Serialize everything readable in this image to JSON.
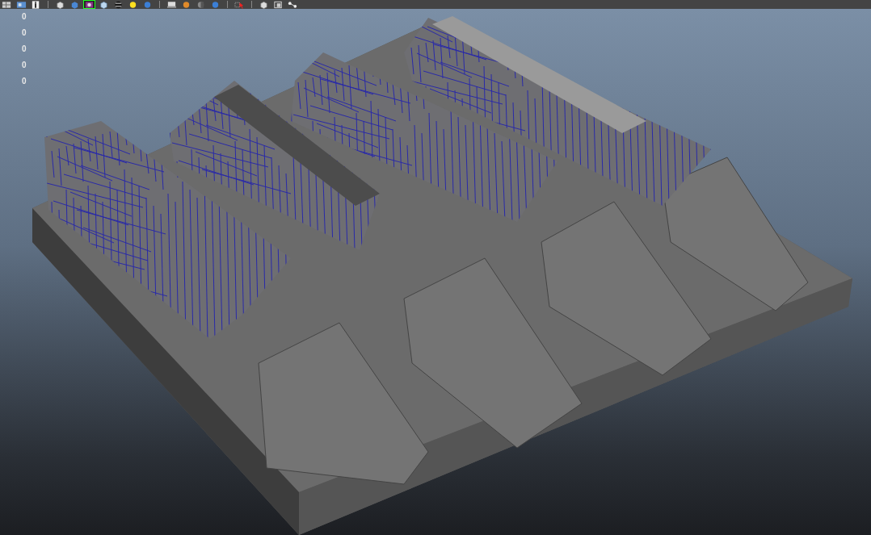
{
  "toolbar": {
    "groups": [
      {
        "buttons": [
          {
            "kind": "grid",
            "selected": false
          },
          {
            "kind": "shaded",
            "selected": false
          },
          {
            "kind": "info",
            "selected": false
          }
        ]
      },
      {
        "buttons": [
          {
            "kind": "cube",
            "selected": false
          },
          {
            "kind": "cube-blue",
            "selected": false
          },
          {
            "kind": "texture",
            "selected": true
          },
          {
            "kind": "cube-light",
            "selected": false
          },
          {
            "kind": "sphere-bw",
            "selected": false
          },
          {
            "kind": "bulb",
            "selected": false
          },
          {
            "kind": "sphere-blue",
            "selected": false
          }
        ]
      },
      {
        "buttons": [
          {
            "kind": "monitor",
            "selected": false
          },
          {
            "kind": "sphere-orange",
            "selected": false
          },
          {
            "kind": "sphere-grey",
            "selected": false
          },
          {
            "kind": "sphere-blue",
            "selected": false
          }
        ]
      },
      {
        "buttons": [
          {
            "kind": "cursor",
            "selected": false
          }
        ]
      },
      {
        "buttons": [
          {
            "kind": "cube",
            "selected": false
          },
          {
            "kind": "frame",
            "selected": false
          },
          {
            "kind": "nodes",
            "selected": false
          }
        ]
      }
    ]
  },
  "hud": {
    "values": [
      "0",
      "0",
      "0",
      "0",
      "0"
    ]
  }
}
